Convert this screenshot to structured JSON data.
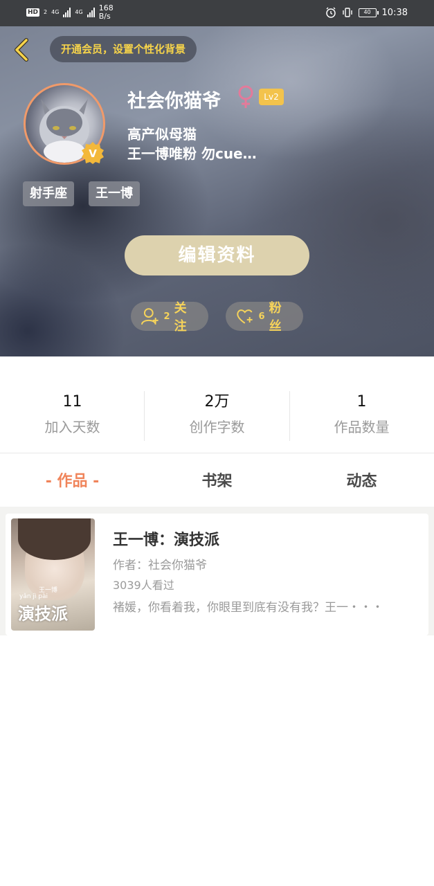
{
  "status_bar": {
    "hd": "HD",
    "sim": "2",
    "net1": "4G",
    "net2": "4G",
    "speed_value": "168",
    "speed_unit": "B/s",
    "battery": "40",
    "time": "10:38"
  },
  "header": {
    "vip_promo": "开通会员，设置个性化背景",
    "username": "社会你猫爷",
    "gender_symbol": "♀",
    "level": "Lv2",
    "bio_line1": "高产似母猫",
    "bio_line2": "王一博唯粉 勿cue…",
    "tags": [
      "射手座",
      "王一博"
    ],
    "edit_profile": "编辑资料",
    "following": {
      "count": "2",
      "label": "关注"
    },
    "followers": {
      "count": "6",
      "label": "粉丝"
    }
  },
  "stats": [
    {
      "value": "11",
      "label": "加入天数"
    },
    {
      "value": "2万",
      "label": "创作字数"
    },
    {
      "value": "1",
      "label": "作品数量"
    }
  ],
  "tabs": [
    {
      "label": "- 作品 -",
      "active": true
    },
    {
      "label": "书架",
      "active": false
    },
    {
      "label": "动态",
      "active": false
    }
  ],
  "works": [
    {
      "title": "王一博：演技派",
      "author": "作者：社会你猫爷",
      "views": "3039人看过",
      "description": "褚媛，你看着我，你眼里到底有没有我？王一・・・",
      "cover_title": "演技派",
      "cover_pinyin": "yǎn  jì  pài",
      "cover_small": "王一博"
    }
  ],
  "colors": {
    "accent": "#f0845a",
    "vip_text": "#f7d44a",
    "level_badge": "#f3c34c",
    "edit_button": "#ddd2ae",
    "gender": "#e47a9a"
  }
}
